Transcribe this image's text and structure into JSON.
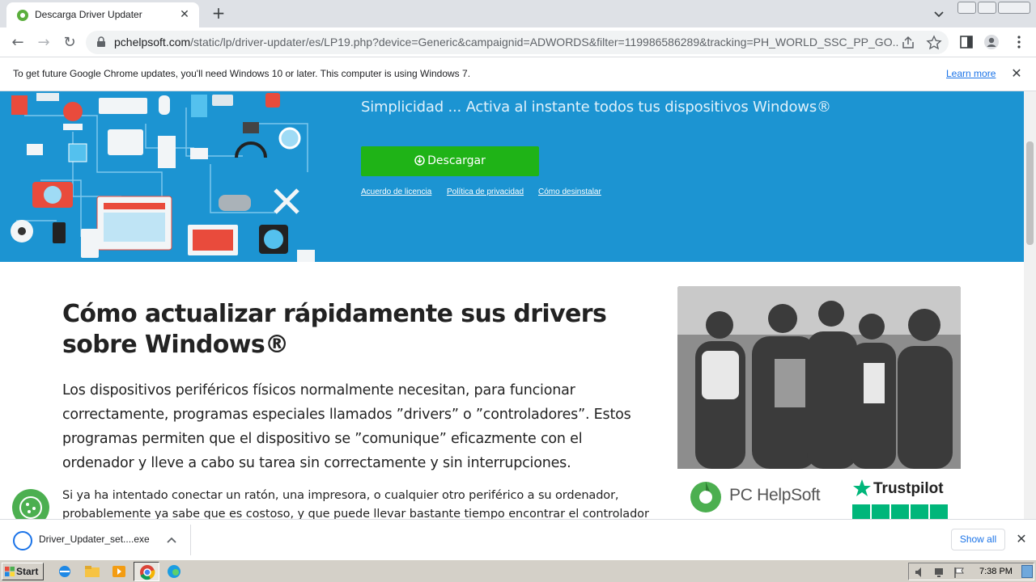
{
  "browser": {
    "tab_title": "Descarga Driver Updater",
    "url_host": "pchelpsoft.com",
    "url_path": "/static/lp/driver-updater/es/LP19.php?device=Generic&campaignid=ADWORDS&filter=119986586289&tracking=PH_WORLD_SSC_PP_GO..."
  },
  "infobar": {
    "message": "To get future Google Chrome updates, you'll need Windows 10 or later. This computer is using Windows 7.",
    "learn_more": "Learn more"
  },
  "hero": {
    "tagline": "Simplicidad ... Activa al instante todos tus dispositivos Windows®",
    "download_label": "Descargar",
    "links": [
      "Acuerdo de licencia",
      "Política de privacidad",
      "Cómo desinstalar"
    ]
  },
  "article": {
    "heading": "Cómo actualizar rápidamente sus drivers sobre Windows®",
    "para1": "Los dispositivos periféricos físicos normalmente necesitan, para funcionar correctamente, programas especiales llamados ”drivers” o ”controladores”. Estos programas permiten que el dispositivo se ”comunique” eficazmente con el ordenador y lleve a cabo su tarea sin correctamente y sin interrupciones.",
    "para2": "Si ya ha intentado conectar un ratón, una impresora, o cualquier otro periférico a su ordenador, probablemente ya sabe que es costoso, y que puede llevar bastante tiempo encontrar el controlador",
    "brand": "PC HelpSoft",
    "trust": "Trustpilot"
  },
  "downloads": {
    "file_name": "Driver_Updater_set....exe",
    "show_all": "Show all"
  },
  "taskbar": {
    "start": "Start",
    "clock": "7:38 PM"
  },
  "colors": {
    "hero_bg": "#1c94d2",
    "download_green": "#1fb317",
    "link_blue": "#1a73e8"
  }
}
